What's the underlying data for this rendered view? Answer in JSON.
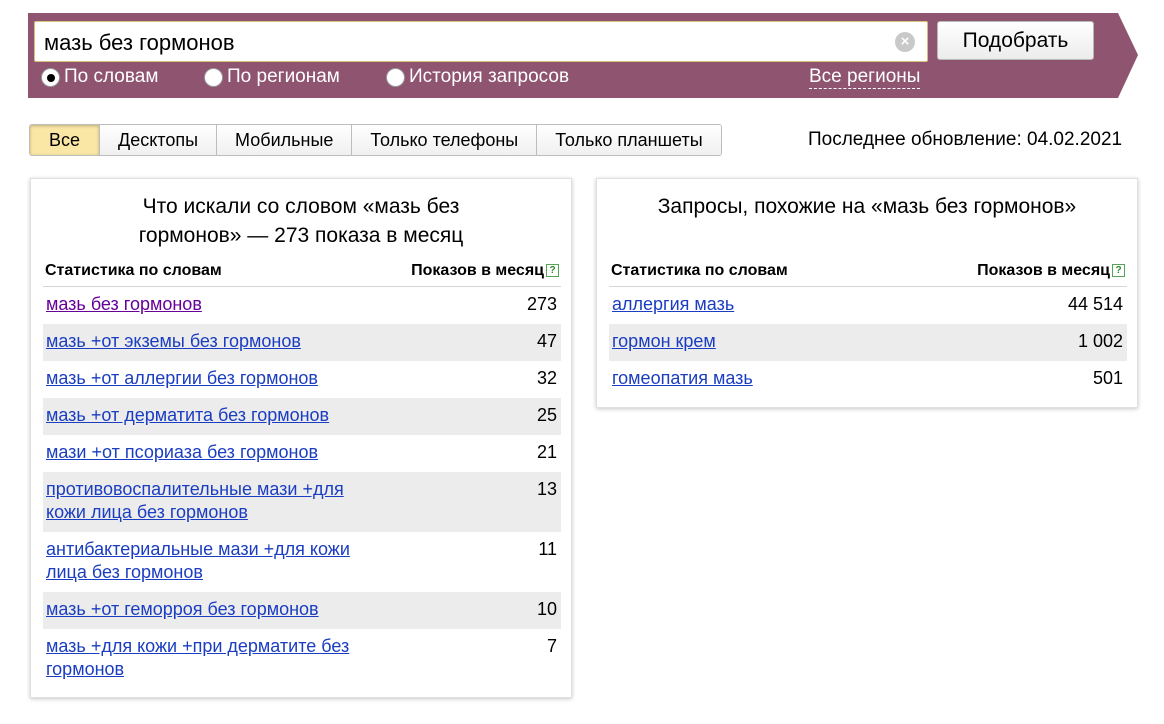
{
  "search": {
    "query": "мазь без гормонов",
    "submit_label": "Подобрать",
    "radios": [
      {
        "label": "По словам",
        "selected": true
      },
      {
        "label": "По регионам",
        "selected": false
      },
      {
        "label": "История запросов",
        "selected": false
      }
    ],
    "regions_link": "Все регионы"
  },
  "tabs": [
    {
      "label": "Все",
      "active": true
    },
    {
      "label": "Десктопы",
      "active": false
    },
    {
      "label": "Мобильные",
      "active": false
    },
    {
      "label": "Только телефоны",
      "active": false
    },
    {
      "label": "Только планшеты",
      "active": false
    }
  ],
  "last_update": "Последнее обновление: 04.02.2021",
  "left_panel": {
    "title_line1": "Что искали со словом «мазь без",
    "title_line2": "гормонов» — 273 показа в месяц",
    "col_phrase": "Статистика по словам",
    "col_count": "Показов в месяц",
    "rows": [
      {
        "line1": "мазь без гормонов",
        "line2": "",
        "count": "273",
        "visited": true
      },
      {
        "line1": "мазь +от экземы без гормонов",
        "line2": "",
        "count": "47"
      },
      {
        "line1": "мазь +от аллергии без гормонов",
        "line2": "",
        "count": "32"
      },
      {
        "line1": "мазь +от дерматита без гормонов",
        "line2": "",
        "count": "25"
      },
      {
        "line1": "мази +от псориаза без гормонов",
        "line2": "",
        "count": "21"
      },
      {
        "line1": "противовоспалительные мази +для",
        "line2": "кожи лица без гормонов",
        "count": "13"
      },
      {
        "line1": "антибактериальные мази +для кожи",
        "line2": "лица без гормонов",
        "count": "11"
      },
      {
        "line1": "мазь +от геморроя без гормонов",
        "line2": "",
        "count": "10"
      },
      {
        "line1": "мазь +для кожи +при дерматите без",
        "line2": "гормонов",
        "count": "7"
      }
    ]
  },
  "right_panel": {
    "title": "Запросы, похожие на «мазь без гормонов»",
    "col_phrase": "Статистика по словам",
    "col_count": "Показов в месяц",
    "rows": [
      {
        "line1": "аллергия мазь",
        "line2": "",
        "count": "44 514"
      },
      {
        "line1": "гормон крем",
        "line2": "",
        "count": "1 002"
      },
      {
        "line1": "гомеопатия мазь",
        "line2": "",
        "count": "501"
      }
    ]
  },
  "colors": {
    "band": "#8e5470",
    "link": "#1a3dc1",
    "visited_link": "#660099",
    "active_tab": "#fbe7a5"
  }
}
